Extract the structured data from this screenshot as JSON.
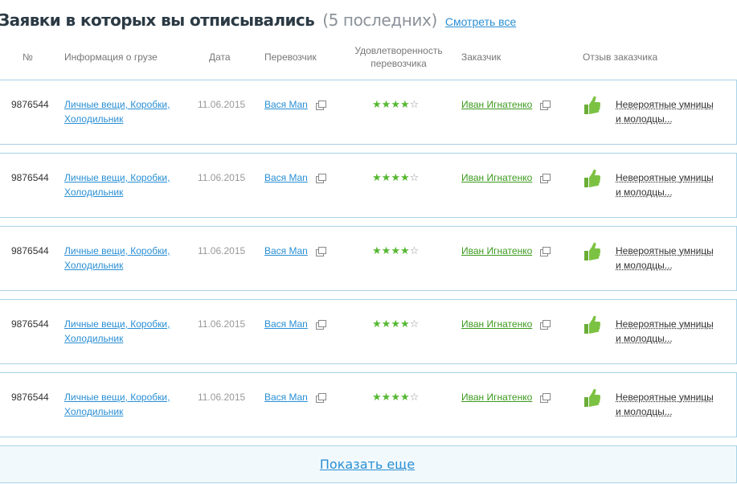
{
  "header": {
    "title": "Заявки в которых вы отписывались",
    "subtitle": "(5 последних)",
    "see_all": "Смотреть все"
  },
  "columns": {
    "num": "№",
    "cargo": "Информация о грузе",
    "date": "Дата",
    "carrier": "Перевозчик",
    "satisfaction_line1": "Удовлетворенность",
    "satisfaction_line2": "перевозчика",
    "customer": "Заказчик",
    "review": "Отзыв заказчика"
  },
  "rows": [
    {
      "num": "9876544",
      "cargo_line1": "Личные вещи, Коробки,",
      "cargo_line2": "Холодильник",
      "date": "11.06.2015",
      "carrier": "Вася Man",
      "rating": 4,
      "rating_max": 5,
      "customer": "Иван Игнатенко",
      "review_line1": "Невероятные умницы",
      "review_line2": "и молодцы..."
    },
    {
      "num": "9876544",
      "cargo_line1": "Личные вещи, Коробки,",
      "cargo_line2": "Холодильник",
      "date": "11.06.2015",
      "carrier": "Вася Man",
      "rating": 4,
      "rating_max": 5,
      "customer": "Иван Игнатенко",
      "review_line1": "Невероятные умницы",
      "review_line2": "и молодцы..."
    },
    {
      "num": "9876544",
      "cargo_line1": "Личные вещи, Коробки,",
      "cargo_line2": "Холодильник",
      "date": "11.06.2015",
      "carrier": "Вася Man",
      "rating": 4,
      "rating_max": 5,
      "customer": "Иван Игнатенко",
      "review_line1": "Невероятные умницы",
      "review_line2": "и молодцы..."
    },
    {
      "num": "9876544",
      "cargo_line1": "Личные вещи, Коробки,",
      "cargo_line2": "Холодильник",
      "date": "11.06.2015",
      "carrier": "Вася Man",
      "rating": 4,
      "rating_max": 5,
      "customer": "Иван Игнатенко",
      "review_line1": "Невероятные умницы",
      "review_line2": "и молодцы..."
    },
    {
      "num": "9876544",
      "cargo_line1": "Личные вещи, Коробки,",
      "cargo_line2": "Холодильник",
      "date": "11.06.2015",
      "carrier": "Вася Man",
      "rating": 4,
      "rating_max": 5,
      "customer": "Иван Игнатенко",
      "review_line1": "Невероятные умницы",
      "review_line2": "и молодцы..."
    }
  ],
  "show_more": "Показать еще",
  "icons": {
    "copy": "copy-icon",
    "thumb": "thumbs-up-icon",
    "star": "star-icon"
  },
  "colors": {
    "link_blue": "#2a8fd4",
    "customer_green": "#3d9a1f",
    "star_green": "#55b832",
    "thumb_green": "#7cc242",
    "border": "#a9d3e6"
  }
}
